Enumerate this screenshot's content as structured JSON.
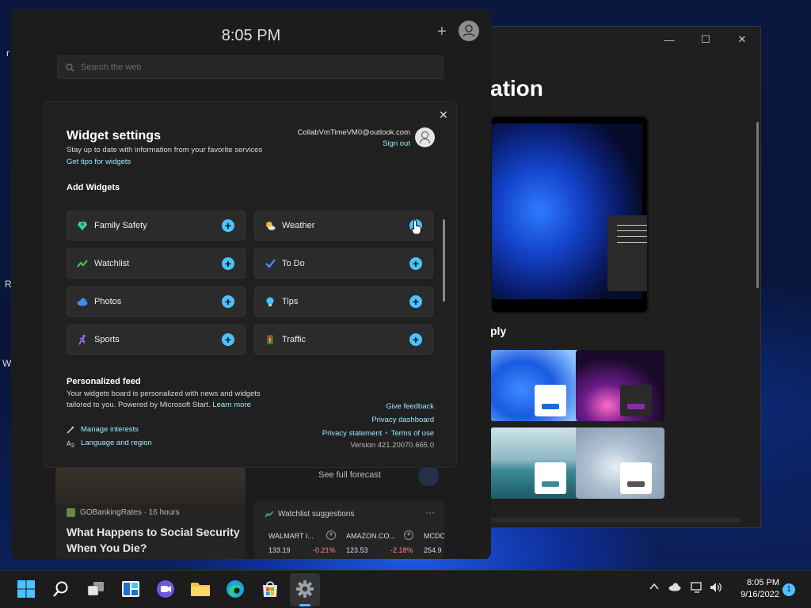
{
  "settings_window": {
    "title_partial": "ation",
    "apply_partial": "ply",
    "controls": {
      "minimize": "—",
      "maximize": "☐",
      "close": "✕"
    }
  },
  "widgets_board": {
    "time": "8:05 PM",
    "add_label": "+",
    "search_placeholder": "Search the web",
    "news": {
      "source": "GOBankingRates · 16 hours",
      "title": "What Happens to Social Security When You Die?"
    },
    "forecast_link": "See full forecast",
    "watchlist": {
      "title": "Watchlist suggestions",
      "more": "···",
      "stocks": [
        {
          "symbol": "WALMART I...",
          "price": "133.19",
          "change": "-0.21%"
        },
        {
          "symbol": "AMAZON.CO...",
          "price": "123.53",
          "change": "-2.18%"
        },
        {
          "symbol": "MCDO",
          "price": "254.9",
          "change": ""
        }
      ]
    }
  },
  "dialog": {
    "close": "✕",
    "title": "Widget settings",
    "subtitle": "Stay up to date with information from your favorite services",
    "tips_link": "Get tips for widgets",
    "account_email": "CollabVmTimeVM0@outlook.com",
    "sign_out": "Sign out",
    "add_widgets_heading": "Add Widgets",
    "widgets": [
      {
        "label": "Family Safety",
        "icon": "family-safety-icon",
        "color": "#3ccfa0"
      },
      {
        "label": "Weather",
        "icon": "weather-icon",
        "color": "#f5b437"
      },
      {
        "label": "Watchlist",
        "icon": "watchlist-icon",
        "color": "#3fbf5a"
      },
      {
        "label": "To Do",
        "icon": "todo-icon",
        "color": "#4a8cff"
      },
      {
        "label": "Photos",
        "icon": "photos-icon",
        "color": "#3a8ef0"
      },
      {
        "label": "Tips",
        "icon": "tips-icon",
        "color": "#4cc2ff"
      },
      {
        "label": "Sports",
        "icon": "sports-icon",
        "color": "#9b6bff"
      },
      {
        "label": "Traffic",
        "icon": "traffic-icon",
        "color": "#d9a23c"
      }
    ],
    "feed": {
      "heading": "Personalized feed",
      "description": "Your widgets board is personalized with news and widgets tailored to you. Powered by Microsoft Start.",
      "learn_more": "Learn more",
      "manage_interests": "Manage interests",
      "language_region": "Language and region",
      "give_feedback": "Give feedback",
      "privacy_dashboard": "Privacy dashboard",
      "privacy_statement": "Privacy statement",
      "terms_of_use": "Terms of use",
      "version": "Version 421.20070.665.0"
    }
  },
  "taskbar": {
    "clock_time": "8:05 PM",
    "clock_date": "9/16/2022",
    "notification_count": "1",
    "tray_chevron": "^"
  },
  "colors": {
    "accent": "#4cc2ff",
    "link": "#99ebff",
    "dialog_bg": "#202020"
  }
}
